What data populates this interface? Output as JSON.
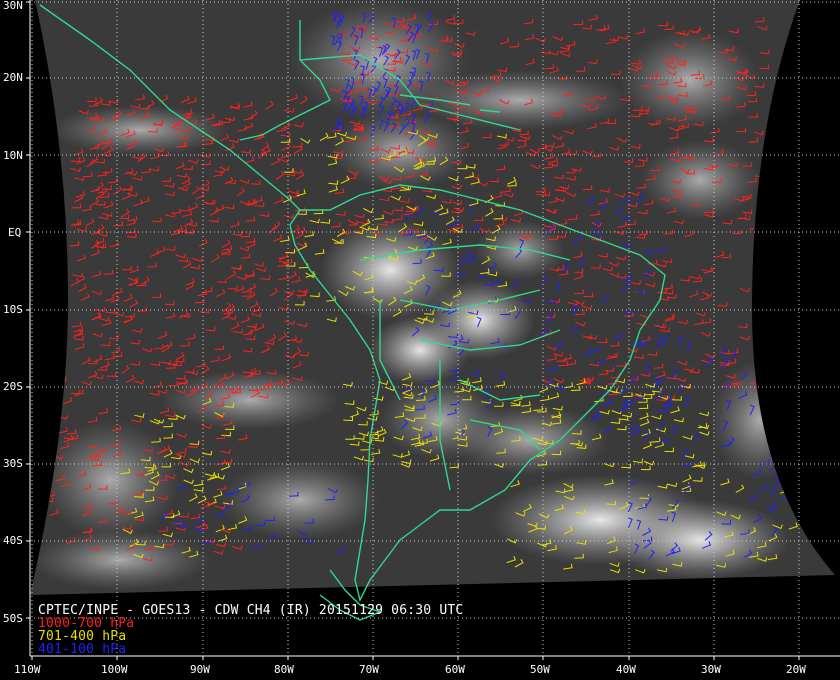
{
  "title": "CPTEC/INPE - GOES13 - CDW CH4 (IR) 20151129 06:30 UTC",
  "legend": [
    {
      "label": "1000-700 hPa",
      "color": "#ff2020"
    },
    {
      "label": "701-400 hPa",
      "color": "#e8e000"
    },
    {
      "label": "401-100 hPa",
      "color": "#2020ff"
    }
  ],
  "lat_labels": [
    "30N",
    "20N",
    "10N",
    "EQ",
    "10S",
    "20S",
    "30S",
    "40S",
    "50S"
  ],
  "lon_labels": [
    "110W",
    "100W",
    "90W",
    "80W",
    "70W",
    "60W",
    "50W",
    "40W",
    "30W",
    "20W"
  ],
  "colors": {
    "background": "#000000",
    "cloud_base": "#3a3a3a",
    "coastline": "#30d890",
    "grid": "#cfcfcf"
  }
}
